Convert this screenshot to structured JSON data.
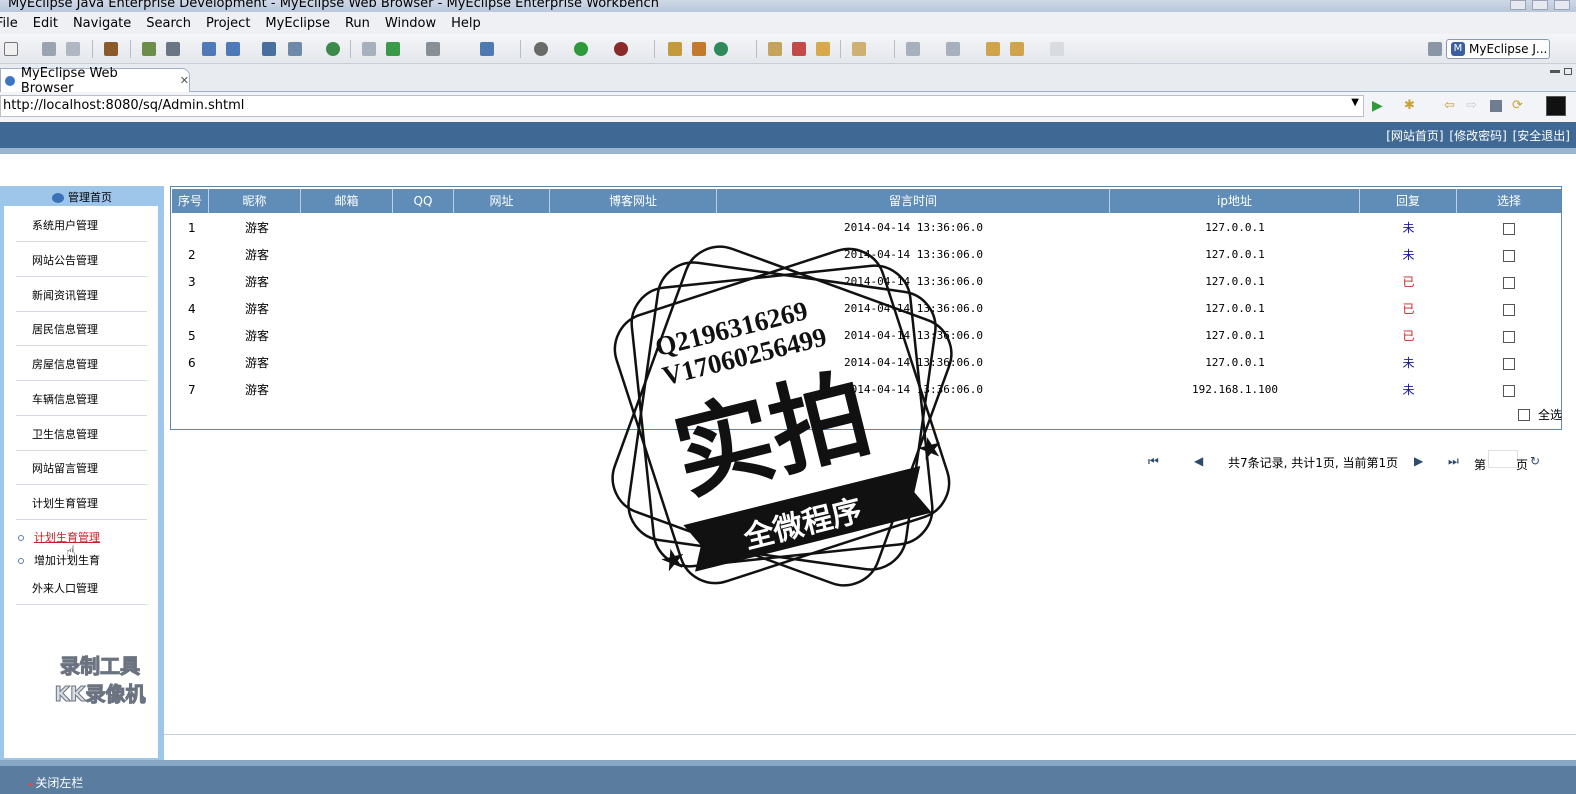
{
  "window": {
    "title": "MyEclipse Java Enterprise Development - MyEclipse Web Browser - MyEclipse Enterprise Workbench"
  },
  "menubar": [
    "File",
    "Edit",
    "Navigate",
    "Search",
    "Project",
    "MyEclipse",
    "Run",
    "Window",
    "Help"
  ],
  "perspective": {
    "label": "MyEclipse J..."
  },
  "tab": {
    "label": "MyEclipse Web Browser"
  },
  "address": {
    "url": "http://localhost:8080/sq/Admin.shtml"
  },
  "page": {
    "top_links": [
      "[网站首页]",
      "[修改密码]",
      "[安全退出]"
    ],
    "sidebar": {
      "head": "管理首页",
      "items": [
        "系统用户管理",
        "网站公告管理",
        "新闻资讯管理",
        "居民信息管理",
        "房屋信息管理",
        "车辆信息管理",
        "卫生信息管理",
        "网站留言管理",
        "计划生育管理"
      ],
      "subitems": [
        "计划生育管理",
        "增加计划生育"
      ],
      "last_item": "外来人口管理"
    },
    "table": {
      "headers": [
        "序号",
        "昵称",
        "邮箱",
        "QQ",
        "网址",
        "博客网址",
        "留言时间",
        "ip地址",
        "回复",
        "选择"
      ],
      "rows": [
        {
          "no": "1",
          "name": "游客",
          "time": "2014-04-14 13:36:06.0",
          "ip": "127.0.0.1",
          "reply": "未"
        },
        {
          "no": "2",
          "name": "游客",
          "time": "2014-04-14 13:36:06.0",
          "ip": "127.0.0.1",
          "reply": "未"
        },
        {
          "no": "3",
          "name": "游客",
          "time": "2014-04-14 13:36:06.0",
          "ip": "127.0.0.1",
          "reply": "已"
        },
        {
          "no": "4",
          "name": "游客",
          "time": "2014-04-14 13:36:06.0",
          "ip": "127.0.0.1",
          "reply": "已"
        },
        {
          "no": "5",
          "name": "游客",
          "time": "2014-04-14 13:36:06.0",
          "ip": "127.0.0.1",
          "reply": "已"
        },
        {
          "no": "6",
          "name": "游客",
          "time": "2014-04-14 13:36:06.0",
          "ip": "127.0.0.1",
          "reply": "未"
        },
        {
          "no": "7",
          "name": "游客",
          "time": "2014-04-14 13:36:06.0",
          "ip": "192.168.1.100",
          "reply": "未"
        }
      ],
      "select_all": "全选"
    },
    "pager": {
      "summary": "共7条记录, 共计1页, 当前第1页",
      "page_prefix": "第",
      "page_suffix": "页"
    },
    "close_left": "关闭左栏"
  },
  "overlays": {
    "stamp_lines": [
      "Q2196316269",
      "V17060256499",
      "实拍",
      "全微程序"
    ],
    "recorder": [
      "录制工具",
      "KK录像机"
    ]
  },
  "colors": {
    "banner": "#3f6894",
    "grid_header": "#5f8db8",
    "reply_yes": "#d02020",
    "reply_no": "#1a1aa0",
    "sidebar_bg": "#9ec6ea"
  }
}
